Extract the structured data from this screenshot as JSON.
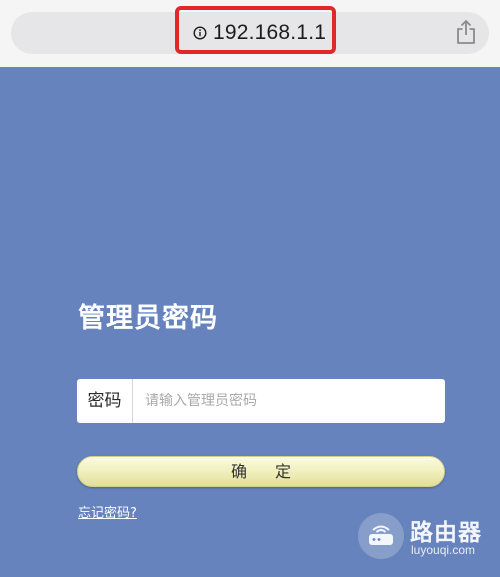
{
  "browser": {
    "url": "192.168.1.1",
    "info_icon": "info-icon",
    "share_icon": "share-icon",
    "highlight_color": "#e2272b"
  },
  "login": {
    "title": "管理员密码",
    "password_label": "密码",
    "password_placeholder": "请输入管理员密码",
    "password_value": "",
    "confirm_label": "确定",
    "forgot_link": "忘记密码?"
  },
  "watermark": {
    "title": "路由器",
    "subtitle": "luyouqi.com",
    "icon": "router-icon"
  },
  "colors": {
    "background": "#6683bd",
    "button": "#efeeb9",
    "text_light": "#ffffff"
  }
}
